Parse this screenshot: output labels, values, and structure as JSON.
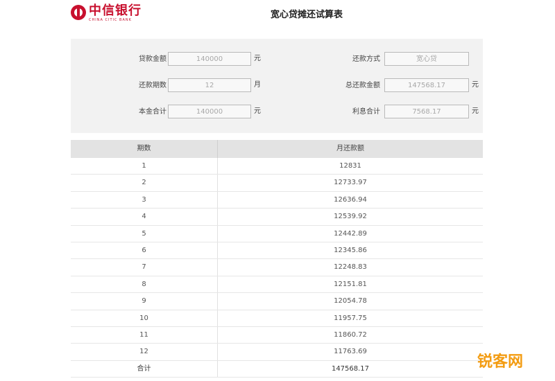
{
  "header": {
    "bank_name_cn": "中信银行",
    "bank_name_en": "CHINA CITIC BANK",
    "title": "宽心贷摊还试算表"
  },
  "form": {
    "loan_amount_label": "贷款金额",
    "loan_amount_value": "140000",
    "repayment_method_label": "还款方式",
    "repayment_method_value": "宽心贷",
    "term_label": "还款期数",
    "term_value": "12",
    "total_repayment_label": "总还款金额",
    "total_repayment_value": "147568.17",
    "principal_total_label": "本金合计",
    "principal_total_value": "140000",
    "interest_total_label": "利息合计",
    "interest_total_value": "7568.17",
    "unit_yuan": "元",
    "unit_month": "月"
  },
  "table": {
    "columns": [
      "期数",
      "月还款额"
    ],
    "rows": [
      [
        "1",
        "12831"
      ],
      [
        "2",
        "12733.97"
      ],
      [
        "3",
        "12636.94"
      ],
      [
        "4",
        "12539.92"
      ],
      [
        "5",
        "12442.89"
      ],
      [
        "6",
        "12345.86"
      ],
      [
        "7",
        "12248.83"
      ],
      [
        "8",
        "12151.81"
      ],
      [
        "9",
        "12054.78"
      ],
      [
        "10",
        "11957.75"
      ],
      [
        "11",
        "11860.72"
      ],
      [
        "12",
        "11763.69"
      ]
    ],
    "total_label": "合计",
    "total_value": "147568.17"
  },
  "watermark": "锐客网",
  "colors": {
    "brand_red": "#c8102e",
    "watermark_orange": "#f39c12",
    "header_gray": "#e3e3e3",
    "form_bg": "#f2f2f2"
  }
}
